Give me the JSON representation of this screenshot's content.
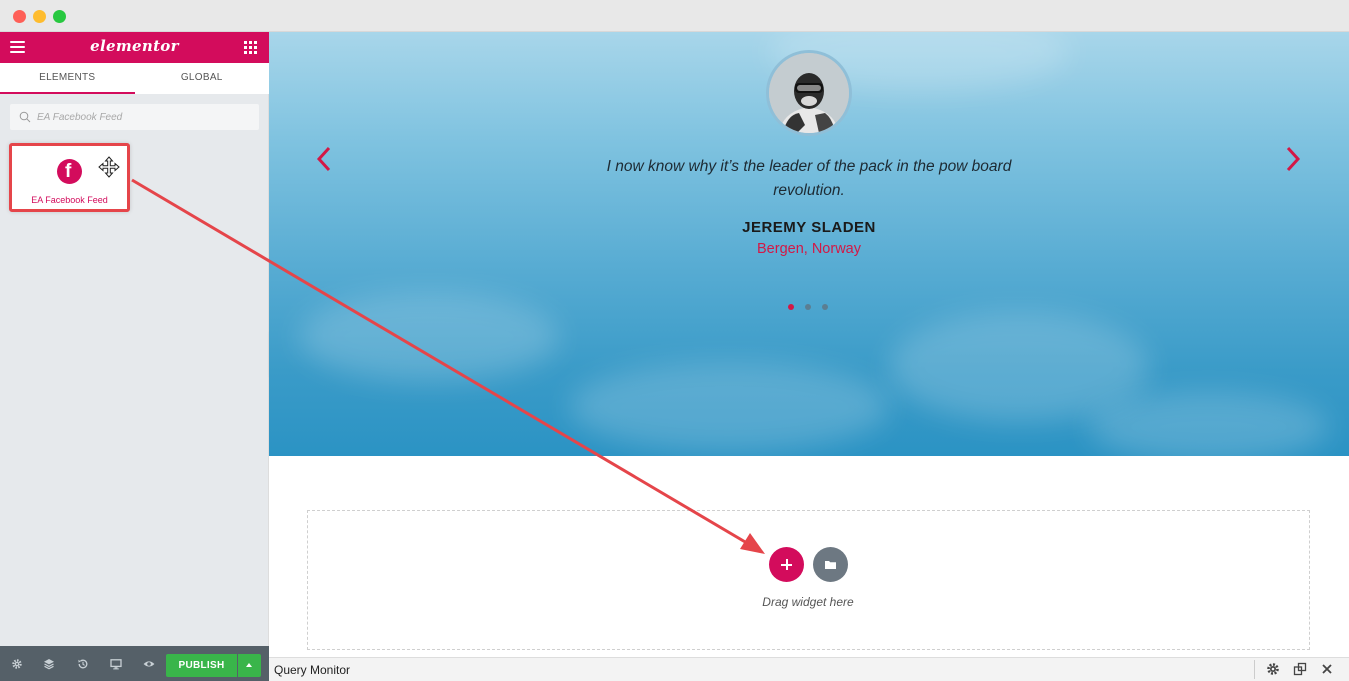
{
  "window": {
    "controls": [
      "close",
      "minimize",
      "maximize"
    ]
  },
  "sidebar": {
    "logo": "elementor",
    "tabs": [
      {
        "label": "ELEMENTS",
        "active": true
      },
      {
        "label": "GLOBAL",
        "active": false
      }
    ],
    "search": {
      "placeholder": "EA Facebook Feed"
    },
    "widget": {
      "label": "EA Facebook Feed",
      "icon": "facebook-icon"
    },
    "footer": {
      "icons": [
        "settings-icon",
        "layers-icon",
        "history-icon",
        "responsive-icon",
        "preview-icon"
      ],
      "publish_label": "PUBLISH"
    }
  },
  "hero": {
    "quote": "I now know why it’s the leader of the pack in the pow board revolution.",
    "name": "JEREMY SLADEN",
    "location": "Bergen, Norway",
    "slides_total": 3,
    "active_slide": 1
  },
  "content": {
    "drag_text": "Drag widget here"
  },
  "query_monitor": {
    "title": "Query Monitor"
  },
  "colors": {
    "accent": "#d30c5c",
    "publish": "#39b54a",
    "annotation": "#e5454a"
  }
}
